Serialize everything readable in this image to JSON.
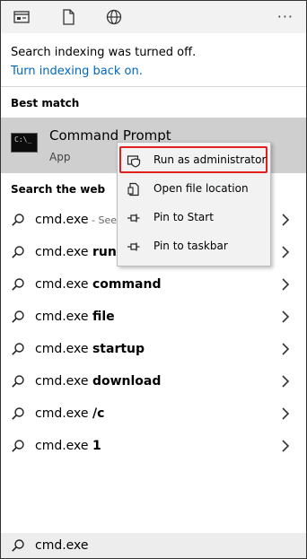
{
  "topbar": {
    "icons": [
      "apps-icon",
      "document-icon",
      "globe-icon"
    ],
    "more_label": "···"
  },
  "notice": {
    "message": "Search indexing was turned off.",
    "link": "Turn indexing back on."
  },
  "best_match": {
    "heading": "Best match",
    "title": "Command Prompt",
    "subtitle": "App",
    "icon_text": "C:\\_"
  },
  "context_menu": {
    "items": [
      {
        "label": "Run as administrator",
        "icon": "shield-icon"
      },
      {
        "label": "Open file location",
        "icon": "file-location-icon"
      },
      {
        "label": "Pin to Start",
        "icon": "pin-icon"
      },
      {
        "label": "Pin to taskbar",
        "icon": "pin-icon"
      }
    ]
  },
  "web": {
    "heading": "Search the web",
    "items": [
      {
        "prefix": "cmd.exe",
        "suffix": "",
        "hint": " - See"
      },
      {
        "prefix": "cmd.exe ",
        "suffix": "run a",
        "hint": ""
      },
      {
        "prefix": "cmd.exe ",
        "suffix": "command",
        "hint": ""
      },
      {
        "prefix": "cmd.exe ",
        "suffix": "file",
        "hint": ""
      },
      {
        "prefix": "cmd.exe ",
        "suffix": "startup",
        "hint": ""
      },
      {
        "prefix": "cmd.exe ",
        "suffix": "download",
        "hint": ""
      },
      {
        "prefix": "cmd.exe ",
        "suffix": "/c",
        "hint": ""
      },
      {
        "prefix": "cmd.exe ",
        "suffix": "1",
        "hint": ""
      }
    ]
  },
  "search": {
    "value": "cmd.exe"
  },
  "colors": {
    "link": "#0067c0",
    "selected_row": "#cfcfcf",
    "highlight_border": "#e02020"
  }
}
